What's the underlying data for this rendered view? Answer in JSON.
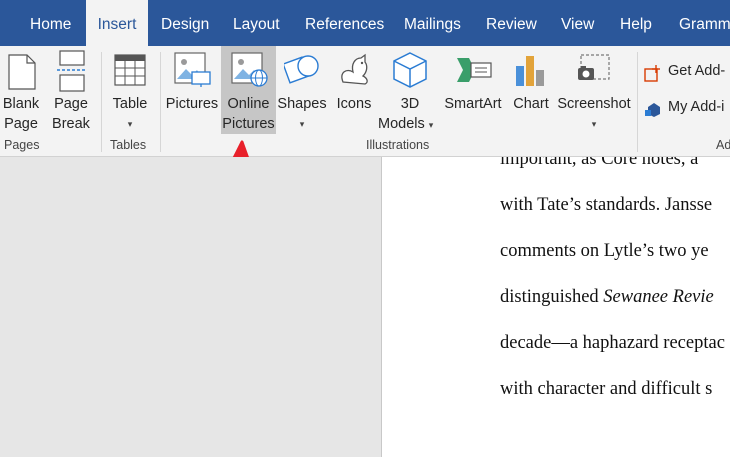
{
  "tabs": [
    "Home",
    "Insert",
    "Design",
    "Layout",
    "References",
    "Mailings",
    "Review",
    "View",
    "Help",
    "Gramm"
  ],
  "active_tab": "Insert",
  "ribbon": {
    "blank_page": [
      "Blank",
      "Page"
    ],
    "page_break": [
      "Page",
      "Break"
    ],
    "table": "Table",
    "pictures": "Pictures",
    "online_pictures": [
      "Online",
      "Pictures"
    ],
    "shapes": "Shapes",
    "icons": "Icons",
    "models": [
      "3D",
      "Models"
    ],
    "smartart": "SmartArt",
    "chart": "Chart",
    "screenshot": "Screenshot",
    "get_addins": "Get Add-",
    "my_addins": "My Add-i",
    "groups": {
      "pages": "Pages",
      "tables": "Tables",
      "illustrations": "Illustrations",
      "addins": "Ad"
    }
  },
  "document": {
    "lines": [
      "important, as Core notes, a",
      "with Tate’s standards. Jansse",
      "comments on Lytle’s two ye",
      {
        "pre": "distinguished ",
        "italic": "Sewanee Revie"
      },
      "decade—a haphazard receptac",
      "with character and difficult s"
    ]
  },
  "colors": {
    "tabbar": "#2b579a",
    "ribbon": "#f3f3f3",
    "arrow": "#e8202a",
    "selected": "#c6c6c6"
  }
}
